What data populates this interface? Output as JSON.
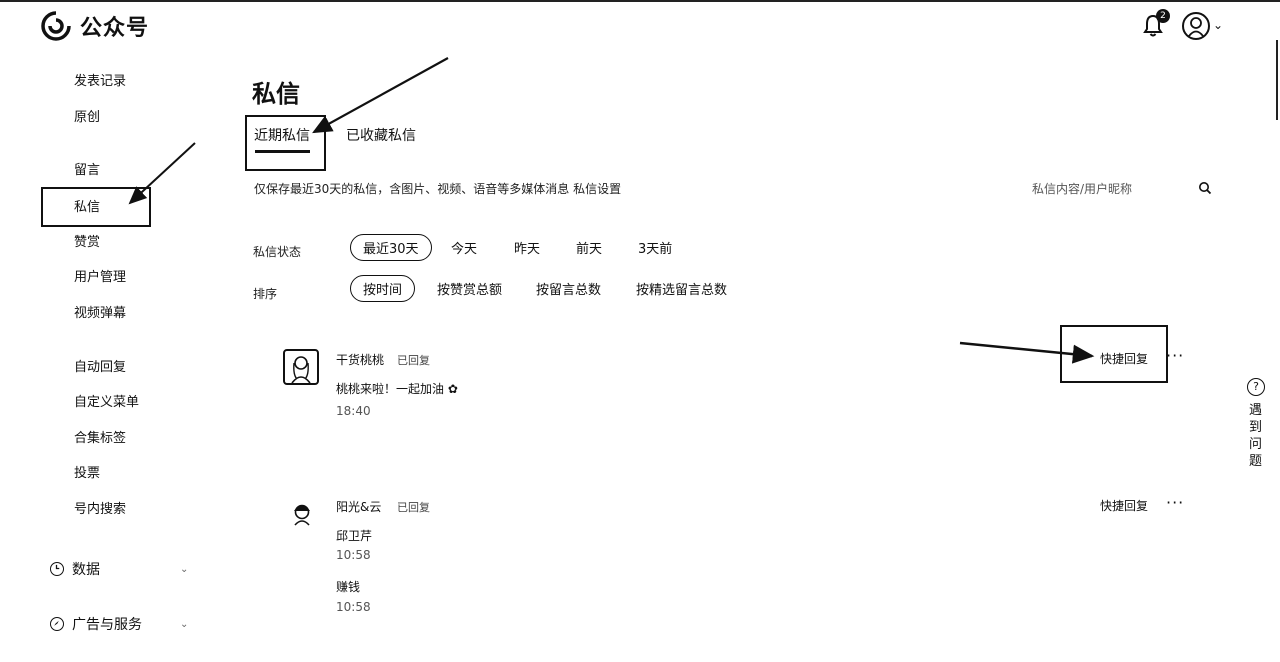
{
  "header": {
    "app_title": "公众号",
    "notification_count": "2"
  },
  "sidebar": {
    "items": [
      {
        "label": "发表记录"
      },
      {
        "label": "原创"
      },
      {
        "label": "留言"
      },
      {
        "label": "私信"
      },
      {
        "label": "赞赏"
      },
      {
        "label": "用户管理"
      },
      {
        "label": "视频弹幕"
      },
      {
        "label": "自动回复"
      },
      {
        "label": "自定义菜单"
      },
      {
        "label": "合集标签"
      },
      {
        "label": "投票"
      },
      {
        "label": "号内搜索"
      }
    ],
    "groups": [
      {
        "label": "数据"
      },
      {
        "label": "广告与服务"
      }
    ]
  },
  "main": {
    "title": "私信",
    "tabs": [
      {
        "label": "近期私信"
      },
      {
        "label": "已收藏私信"
      }
    ],
    "notice": "仅保存最近30天的私信，含图片、视频、语音等多媒体消息 私信设置",
    "search_placeholder": "私信内容/用户昵称",
    "filters": {
      "status_label": "私信状态",
      "status_options": [
        "最近30天",
        "今天",
        "昨天",
        "前天",
        "3天前"
      ],
      "sort_label": "排序",
      "sort_options": [
        "按时间",
        "按赞赏总额",
        "按留言总数",
        "按精选留言总数"
      ]
    },
    "messages": [
      {
        "name": "干货桃桃",
        "status": "已回复",
        "lines": [
          {
            "text": "桃桃来啦！一起加油",
            "emoji": "✿",
            "time": "18:40"
          }
        ],
        "quick_reply": "快捷回复",
        "more": "···"
      },
      {
        "name": "阳光&云",
        "status": "已回复",
        "lines": [
          {
            "text": "邱卫芹",
            "time": "10:58"
          },
          {
            "text": "赚钱",
            "time": "10:58"
          }
        ],
        "quick_reply": "快捷回复",
        "more": "···"
      }
    ]
  },
  "help": {
    "icon": "?",
    "label": "遇到问题"
  }
}
